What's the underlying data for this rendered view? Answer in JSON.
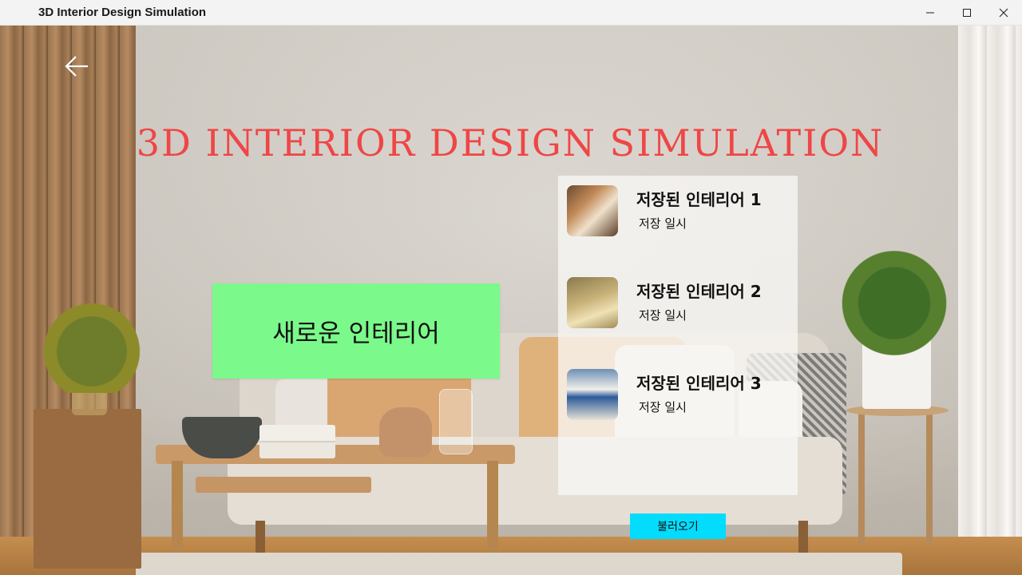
{
  "window": {
    "title": "3D Interior Design Simulation"
  },
  "header": {
    "title": "3D INTERIOR DESIGN SIMULATION"
  },
  "actions": {
    "new_interior_label": "새로운 인테리어",
    "load_label": "불러오기"
  },
  "saved_list": {
    "items": [
      {
        "name": "저장된 인테리어 1",
        "date": "저장 일시"
      },
      {
        "name": "저장된 인테리어 2",
        "date": "저장 일시"
      },
      {
        "name": "저장된 인테리어 3",
        "date": "저장 일시"
      }
    ]
  },
  "colors": {
    "title": "#ef4646",
    "new_button": "#7bf98a",
    "load_button": "#03dcfd"
  }
}
